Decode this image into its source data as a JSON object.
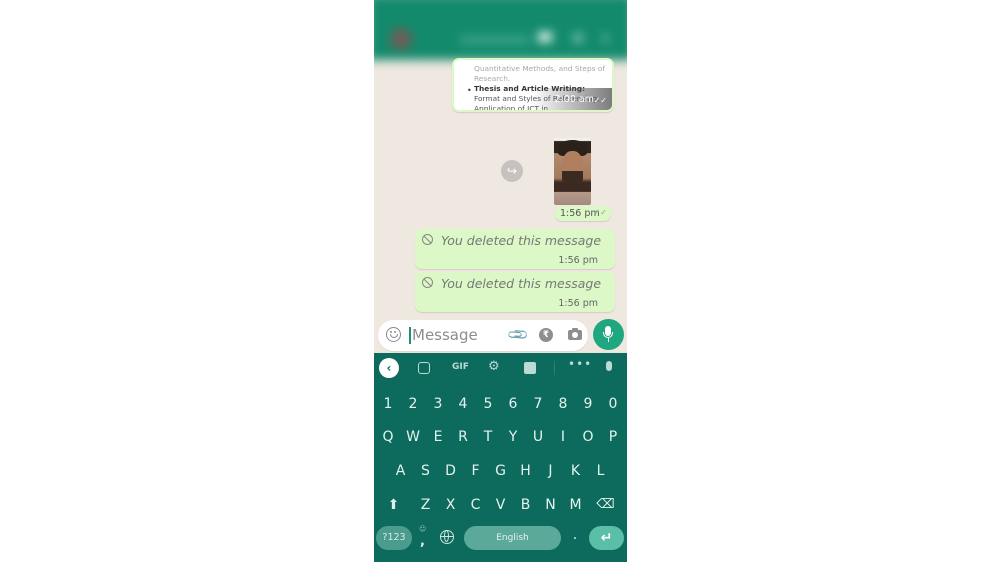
{
  "chat": {
    "header": {
      "contact_name_blurred": true
    },
    "messages": [
      {
        "type": "document",
        "lines_faded": "Quantitative Methods, and Steps of Research.",
        "bullet": "•",
        "bold_text": "Thesis and Article Writing:",
        "normal_text": " Format and Styles of Referencing, Application of ICT in",
        "time": "2:00 am",
        "ticks": "✓✓"
      },
      {
        "type": "image",
        "time": "1:56 pm",
        "ticks": "✓✓",
        "forward_icon": "↪"
      },
      {
        "type": "deleted",
        "text": "You deleted this message",
        "time": "1:56 pm"
      },
      {
        "type": "deleted",
        "text": "You deleted this message",
        "time": "1:56 pm"
      }
    ]
  },
  "composer": {
    "placeholder": "Message",
    "value": "",
    "attach_icon": "📎",
    "rupee_icon": "₹"
  },
  "keyboard": {
    "toolbar": {
      "back": "‹",
      "gif": "GIF",
      "gear": "⚙",
      "more": "•••"
    },
    "rows": [
      [
        "1",
        "2",
        "3",
        "4",
        "5",
        "6",
        "7",
        "8",
        "9",
        "0"
      ],
      [
        "Q",
        "W",
        "E",
        "R",
        "T",
        "Y",
        "U",
        "I",
        "O",
        "P"
      ],
      [
        "A",
        "S",
        "D",
        "F",
        "G",
        "H",
        "J",
        "K",
        "L"
      ],
      [
        "Z",
        "X",
        "C",
        "V",
        "B",
        "N",
        "M"
      ]
    ],
    "shift": "⬆",
    "backspace": "⌫",
    "symbols": "?123",
    "comma_secondary": "☺",
    "comma": ",",
    "space_label": "English",
    "period": ".",
    "enter": "↵"
  }
}
